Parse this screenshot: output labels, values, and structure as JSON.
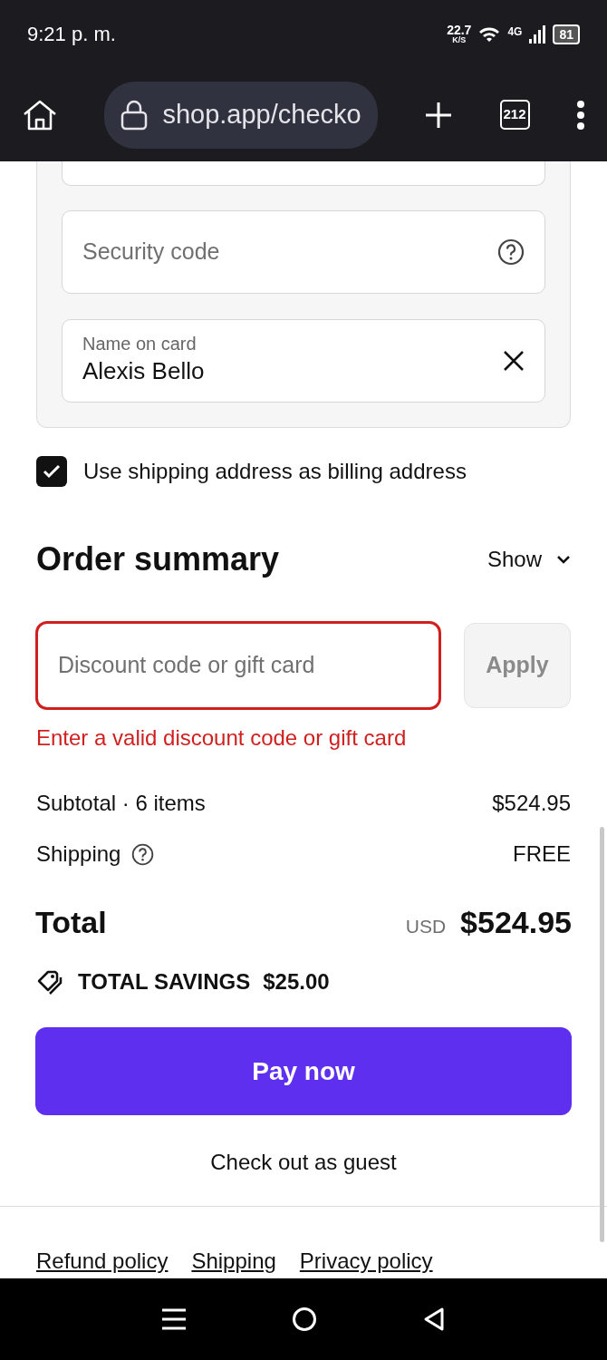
{
  "status_bar": {
    "time": "9:21 p. m.",
    "speed": "22.7",
    "speed_unit": "K/S",
    "network": "4G",
    "battery": "81"
  },
  "browser": {
    "url": "shop.app/checko",
    "tab_count": "212"
  },
  "payment": {
    "fields": [
      {
        "kind": "placeholder",
        "placeholder": "Security code",
        "has_help": true
      },
      {
        "kind": "filled",
        "label": "Name on card",
        "value": "Alexis Bello",
        "clearable": true
      }
    ]
  },
  "billing_checkbox": {
    "label": "Use shipping address as billing address",
    "checked": true
  },
  "order_summary": {
    "title": "Order summary",
    "toggle": "Show",
    "discount": {
      "placeholder": "Discount code or gift card",
      "invalid": true,
      "error": "Enter a valid discount code or gift card",
      "button": "Apply"
    },
    "lines": [
      {
        "label": "Subtotal · 6 items",
        "value": "$524.95",
        "help": false
      },
      {
        "label": "Shipping",
        "value": "FREE",
        "help": true
      }
    ],
    "total": {
      "label": "Total",
      "currency": "USD",
      "value": "$524.95"
    },
    "savings": {
      "label": "TOTAL SAVINGS",
      "value": "$25.00"
    },
    "pay_button": "Pay now",
    "guest_link": "Check out as guest"
  },
  "footer_links": [
    "Refund policy",
    "Shipping",
    "Privacy policy"
  ]
}
